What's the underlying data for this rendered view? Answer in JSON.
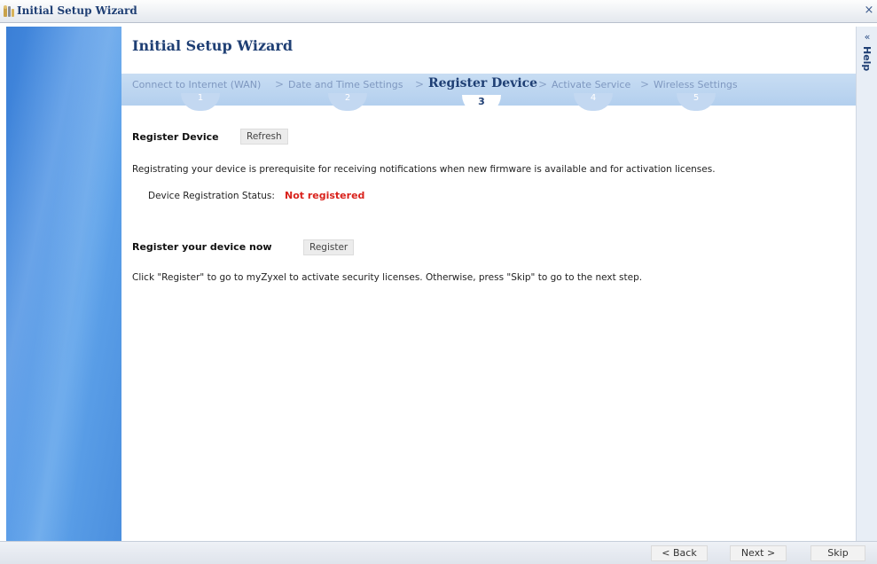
{
  "window": {
    "title": "Initial Setup Wizard",
    "close_label": "×"
  },
  "wizard": {
    "heading": "Initial Setup Wizard",
    "steps": [
      {
        "label": "Connect to Internet (WAN)",
        "number": "1"
      },
      {
        "label": "Date and Time Settings",
        "number": "2"
      },
      {
        "label": "Register Device",
        "number": "3"
      },
      {
        "label": "Activate Service",
        "number": "4"
      },
      {
        "label": "Wireless Settings",
        "number": "5"
      }
    ],
    "separator": ">"
  },
  "register": {
    "section_title": "Register Device",
    "refresh_label": "Refresh",
    "description": "Registrating your device is prerequisite for receiving notifications when new firmware is available and for activation licenses.",
    "status_label": "Device Registration Status:",
    "status_value": "Not registered",
    "status_color": "#d9221c"
  },
  "register_now": {
    "section_title": "Register your device now",
    "register_label": "Register",
    "description": "Click \"Register\" to go to myZyxel to activate security licenses. Otherwise, press \"Skip\" to go to the next step."
  },
  "help": {
    "collapse_label": "«",
    "label": "Help"
  },
  "footer": {
    "back_label": "< Back",
    "next_label": "Next >",
    "skip_label": "Skip"
  },
  "colors": {
    "heading": "#1f3f74",
    "steps_bar": "#b3cfee",
    "left_panel": "#4a91e4"
  }
}
